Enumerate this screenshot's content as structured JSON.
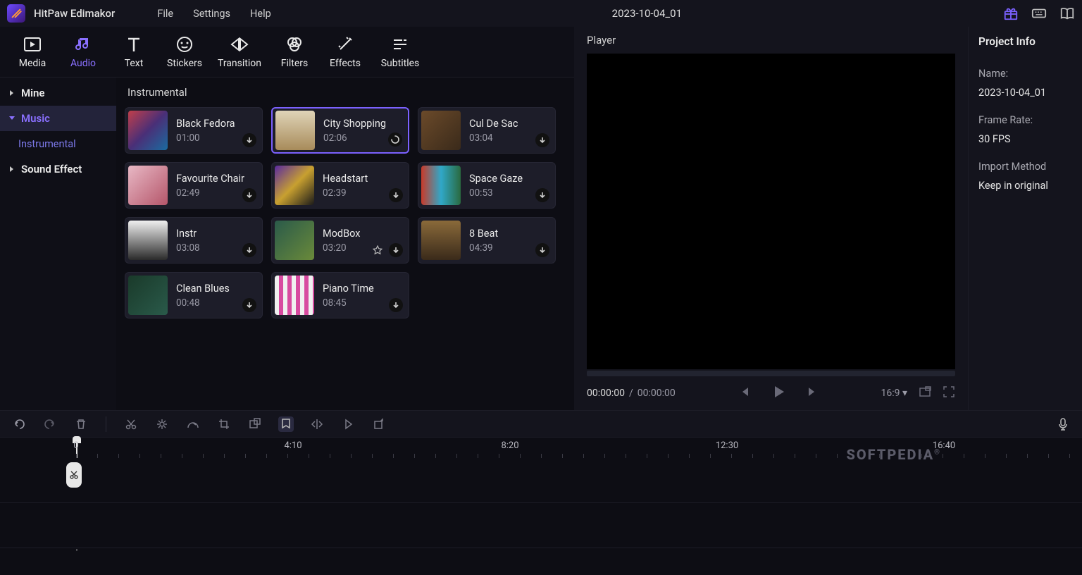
{
  "app": {
    "name": "HitPaw Edimakor"
  },
  "menubar": {
    "items": [
      "File",
      "Settings",
      "Help"
    ],
    "project": "2023-10-04_01"
  },
  "toolbar": [
    {
      "id": "media",
      "label": "Media"
    },
    {
      "id": "audio",
      "label": "Audio"
    },
    {
      "id": "text",
      "label": "Text"
    },
    {
      "id": "stickers",
      "label": "Stickers"
    },
    {
      "id": "transition",
      "label": "Transition"
    },
    {
      "id": "filters",
      "label": "Filters"
    },
    {
      "id": "effects",
      "label": "Effects"
    },
    {
      "id": "subtitles",
      "label": "Subtitles"
    }
  ],
  "rail": {
    "mine": "Mine",
    "music": "Music",
    "instrumental": "Instrumental",
    "soundeffect": "Sound Effect"
  },
  "content": {
    "header": "Instrumental",
    "tracks": [
      {
        "title": "Black Fedora",
        "dur": "01:00",
        "thumb": "linear-gradient(135deg,#c13f4a,#4a2f77,#1a6ba0)",
        "action": "download"
      },
      {
        "title": "City Shopping",
        "dur": "02:06",
        "thumb": "linear-gradient(180deg,#e0d4b8,#a88b5a)",
        "action": "loading",
        "selected": true
      },
      {
        "title": "Cul De Sac",
        "dur": "03:04",
        "thumb": "linear-gradient(135deg,#6b4a2a,#3a2a1a)",
        "action": "download"
      },
      {
        "title": "Favourite Chair",
        "dur": "02:49",
        "thumb": "linear-gradient(135deg,#e8b8c5,#b5566a)",
        "action": "download"
      },
      {
        "title": "Headstart",
        "dur": "02:39",
        "thumb": "linear-gradient(135deg,#5a2aa0,#c8a030,#1a1a1a)",
        "action": "download"
      },
      {
        "title": "Space Gaze",
        "dur": "00:53",
        "thumb": "linear-gradient(90deg,#c83a2a,#30a8c8,#2a6a40)",
        "action": "download"
      },
      {
        "title": "Instr",
        "dur": "03:08",
        "thumb": "linear-gradient(180deg,#f0f0f0,#2a2a2a)",
        "action": "download"
      },
      {
        "title": "ModBox",
        "dur": "03:20",
        "thumb": "linear-gradient(135deg,#2a5a4a,#6a8a3a)",
        "action": "download",
        "fav": true
      },
      {
        "title": "8 Beat",
        "dur": "04:39",
        "thumb": "linear-gradient(180deg,#8a6a3a,#3a2a1a)",
        "action": "download"
      },
      {
        "title": "Clean Blues",
        "dur": "00:48",
        "thumb": "linear-gradient(135deg,#1a3a2a,#2a5a4a)",
        "action": "download"
      },
      {
        "title": "Piano Time",
        "dur": "08:45",
        "thumb": "repeating-linear-gradient(90deg,#f0f0f0 0 6px,#d84aa0 6px 12px)",
        "action": "download"
      }
    ]
  },
  "player": {
    "title": "Player",
    "timeCurrent": "00:00:00",
    "timeTotal": "00:00:00",
    "aspect": "16:9"
  },
  "info": {
    "header": "Project Info",
    "nameLabel": "Name:",
    "nameValue": "2023-10-04_01",
    "fpsLabel": "Frame Rate:",
    "fpsValue": "30 FPS",
    "importLabel": "Import Method",
    "importValue": "Keep in original"
  },
  "timeline": {
    "ticks": [
      "0",
      "4:10",
      "8:20",
      "12:30",
      "16:40"
    ]
  },
  "watermark": "SOFTPEDIA"
}
